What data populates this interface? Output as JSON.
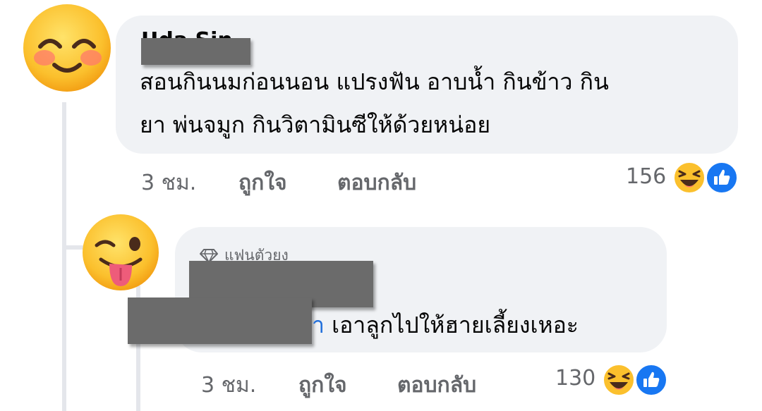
{
  "comment": {
    "author": "Uda Sin",
    "text_line1": "สอนกินนมก่อนนอน แปรงฟัน อาบน้ำ กินข้าว กิน",
    "text_line2": "ยา พ่นจมูก กินวิตามินซีให้ด้วยหน่อย",
    "time": "3 ชม.",
    "like_label": "ถูกใจ",
    "reply_label": "ตอบกลับ",
    "reaction_count": "156",
    "reaction_icons": [
      "laugh-emoji",
      "like-thumb"
    ]
  },
  "reply": {
    "badge": "แฟนตัวยง",
    "mention_tail": "า",
    "text": "เอาลูกไปให้ฮายเลี้ยงเหอะ",
    "time": "3 ชม.",
    "like_label": "ถูกใจ",
    "reply_label": "ตอบกลับ",
    "reaction_count": "130",
    "reaction_icons": [
      "laugh-emoji",
      "like-thumb"
    ]
  },
  "colors": {
    "bubble": "#f0f2f5",
    "meta_text": "#65676b",
    "mention": "#216fdb",
    "like_blue": "#1877f2",
    "emoji_yellow": "#fbc02d"
  }
}
